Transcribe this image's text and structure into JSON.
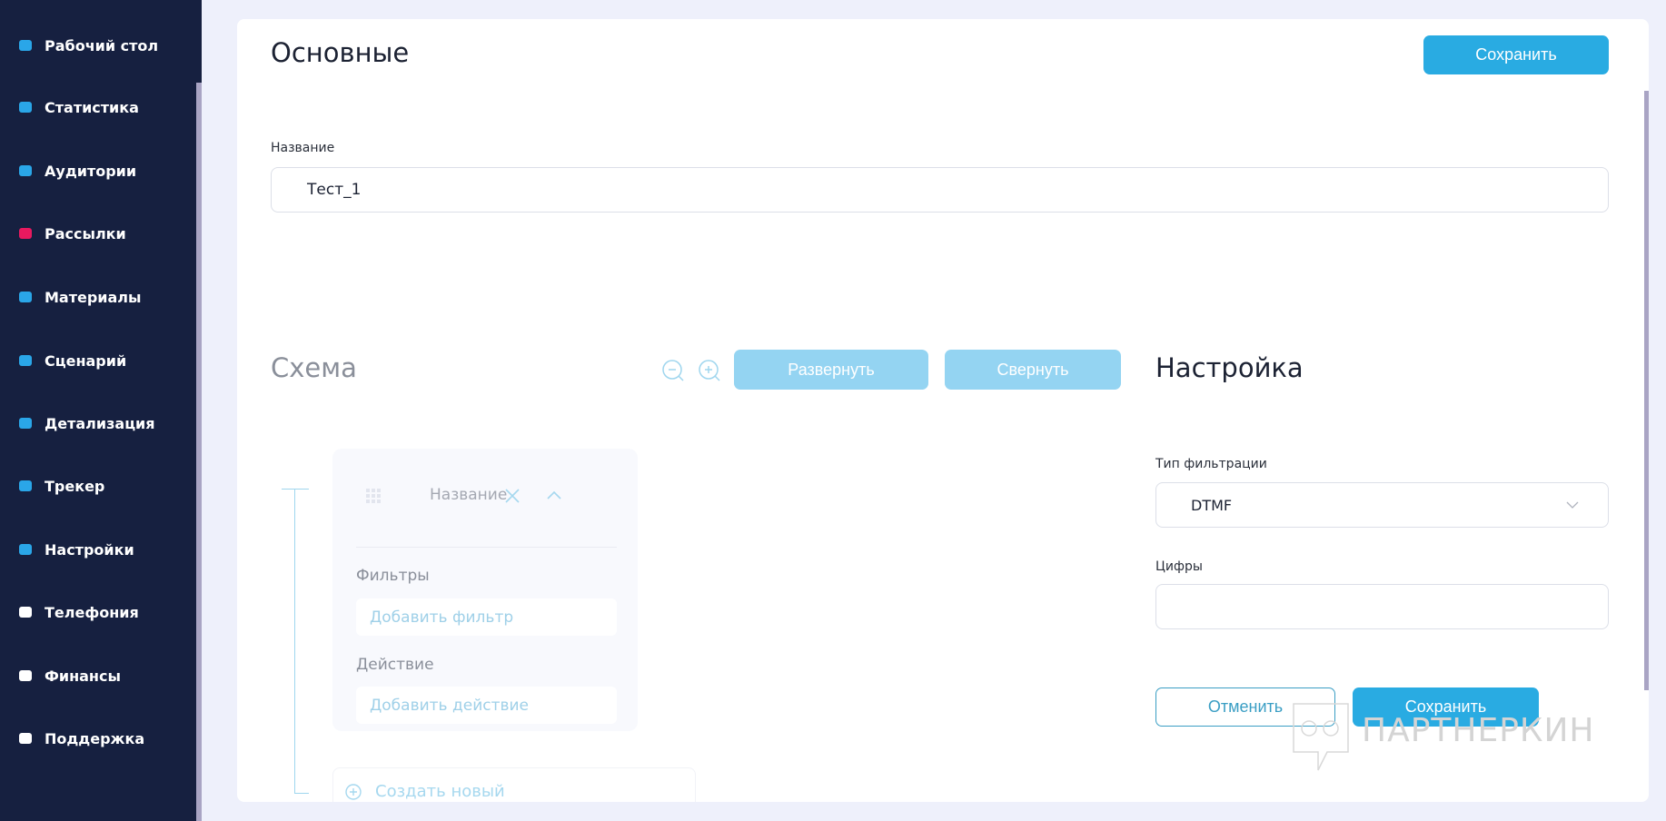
{
  "sidebar": {
    "items": [
      {
        "label": "Рабочий стол",
        "icon": "dashboard-icon",
        "color": "#2aa6e8"
      },
      {
        "label": "Статистика",
        "icon": "chart-icon",
        "color": "#2aa6e8"
      },
      {
        "label": "Аудитории",
        "icon": "users-icon",
        "color": "#2aa6e8"
      },
      {
        "label": "Рассылки",
        "icon": "mail-icon",
        "color": "#e8195f"
      },
      {
        "label": "Материалы",
        "icon": "files-icon",
        "color": "#2aa6e8"
      },
      {
        "label": "Сценарий",
        "icon": "scenario-icon",
        "color": "#2aa6e8"
      },
      {
        "label": "Детализация",
        "icon": "details-icon",
        "color": "#2aa6e8"
      },
      {
        "label": "Трекер",
        "icon": "tracker-icon",
        "color": "#2aa6e8"
      },
      {
        "label": "Настройки",
        "icon": "gear-icon",
        "color": "#2aa6e8"
      },
      {
        "label": "Телефония",
        "icon": "phone-icon",
        "color": "#ffffff"
      },
      {
        "label": "Финансы",
        "icon": "card-icon",
        "color": "#ffffff"
      },
      {
        "label": "Поддержка",
        "icon": "support-icon",
        "color": "#ffffff"
      }
    ]
  },
  "main": {
    "title": "Основные",
    "save_label": "Сохранить",
    "name_label": "Название",
    "name_value": "Тест_1"
  },
  "scheme": {
    "title": "Схема",
    "expand_label": "Развернуть",
    "collapse_label": "Свернуть",
    "node": {
      "title": "Название",
      "filters_label": "Фильтры",
      "add_filter": "Добавить фильтр",
      "action_label": "Действие",
      "add_action": "Добавить действие"
    },
    "create_new": "Создать новый"
  },
  "settings": {
    "title": "Настройка",
    "filter_type_label": "Тип фильтрации",
    "filter_type_value": "DTMF",
    "digits_label": "Цифры",
    "digits_value": "",
    "cancel_label": "Отменить",
    "save_label": "Сохранить"
  },
  "watermark": "ПАРТНЕРКИН",
  "colors": {
    "accent": "#29abe2",
    "accent_light": "#94d4f2",
    "sidebar": "#162040"
  }
}
